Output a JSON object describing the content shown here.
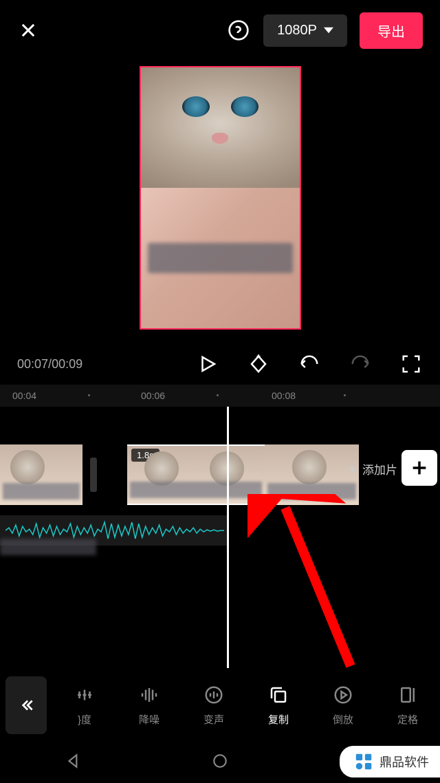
{
  "header": {
    "resolution": "1080P",
    "export_label": "导出"
  },
  "playback": {
    "current_time": "00:07",
    "total_time": "00:09"
  },
  "ruler": {
    "ticks": [
      "00:04",
      "00:06",
      "00:08"
    ]
  },
  "clips": {
    "selected_duration": "1.8s",
    "add_clip_label": "添加片"
  },
  "toolbar": {
    "items": [
      {
        "label": "}度",
        "icon": "speed"
      },
      {
        "label": "降噪",
        "icon": "denoise"
      },
      {
        "label": "变声",
        "icon": "voice"
      },
      {
        "label": "复制",
        "icon": "copy",
        "active": true
      },
      {
        "label": "倒放",
        "icon": "reverse"
      },
      {
        "label": "定格",
        "icon": "freeze"
      }
    ]
  },
  "watermark": {
    "text": "鼎品软件"
  }
}
